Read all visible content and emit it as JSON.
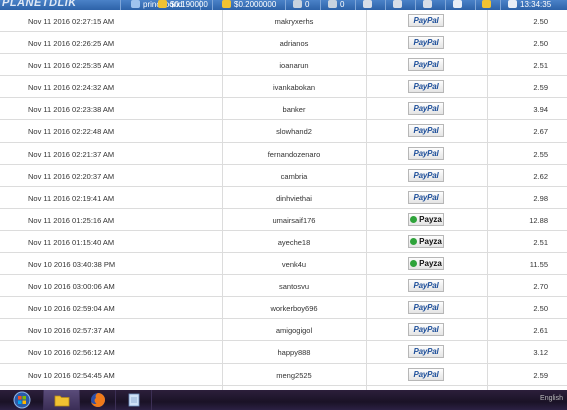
{
  "header": {
    "logo": "PLANETDLIK",
    "username": "princebond",
    "balance1": "$0.190000",
    "balance2": "$0.2000000",
    "count1": "0",
    "count2": "0",
    "clock": "13:34:35"
  },
  "rows": [
    {
      "date": "Nov 11 2016 02:27:15 AM",
      "user": "makryxerhs",
      "processor": "PayPal",
      "amount": "2.50"
    },
    {
      "date": "Nov 11 2016 02:26:25 AM",
      "user": "adrianos",
      "processor": "PayPal",
      "amount": "2.50"
    },
    {
      "date": "Nov 11 2016 02:25:35 AM",
      "user": "ioanarun",
      "processor": "PayPal",
      "amount": "2.51"
    },
    {
      "date": "Nov 11 2016 02:24:32 AM",
      "user": "ivankabokan",
      "processor": "PayPal",
      "amount": "2.59"
    },
    {
      "date": "Nov 11 2016 02:23:38 AM",
      "user": "banker",
      "processor": "PayPal",
      "amount": "3.94"
    },
    {
      "date": "Nov 11 2016 02:22:48 AM",
      "user": "slowhand2",
      "processor": "PayPal",
      "amount": "2.67"
    },
    {
      "date": "Nov 11 2016 02:21:37 AM",
      "user": "fernandozenaro",
      "processor": "PayPal",
      "amount": "2.55"
    },
    {
      "date": "Nov 11 2016 02:20:37 AM",
      "user": "cambria",
      "processor": "PayPal",
      "amount": "2.62"
    },
    {
      "date": "Nov 11 2016 02:19:41 AM",
      "user": "dinhviethai",
      "processor": "PayPal",
      "amount": "2.98"
    },
    {
      "date": "Nov 11 2016 01:25:16 AM",
      "user": "umairsaif176",
      "processor": "Payza",
      "amount": "12.88"
    },
    {
      "date": "Nov 11 2016 01:15:40 AM",
      "user": "ayeche18",
      "processor": "Payza",
      "amount": "2.51"
    },
    {
      "date": "Nov 10 2016 03:40:38 PM",
      "user": "venk4u",
      "processor": "Payza",
      "amount": "11.55"
    },
    {
      "date": "Nov 10 2016 03:00:06 AM",
      "user": "santosvu",
      "processor": "PayPal",
      "amount": "2.70"
    },
    {
      "date": "Nov 10 2016 02:59:04 AM",
      "user": "workerboy696",
      "processor": "PayPal",
      "amount": "2.50"
    },
    {
      "date": "Nov 10 2016 02:57:37 AM",
      "user": "amigogigol",
      "processor": "PayPal",
      "amount": "2.61"
    },
    {
      "date": "Nov 10 2016 02:56:12 AM",
      "user": "happy888",
      "processor": "PayPal",
      "amount": "3.12"
    },
    {
      "date": "Nov 10 2016 02:54:45 AM",
      "user": "meng2525",
      "processor": "PayPal",
      "amount": "2.59"
    }
  ],
  "taskbar": {
    "apps": [
      "start-orb-icon",
      "folder-icon",
      "firefox-icon",
      "notepad-icon"
    ],
    "language": "English"
  }
}
